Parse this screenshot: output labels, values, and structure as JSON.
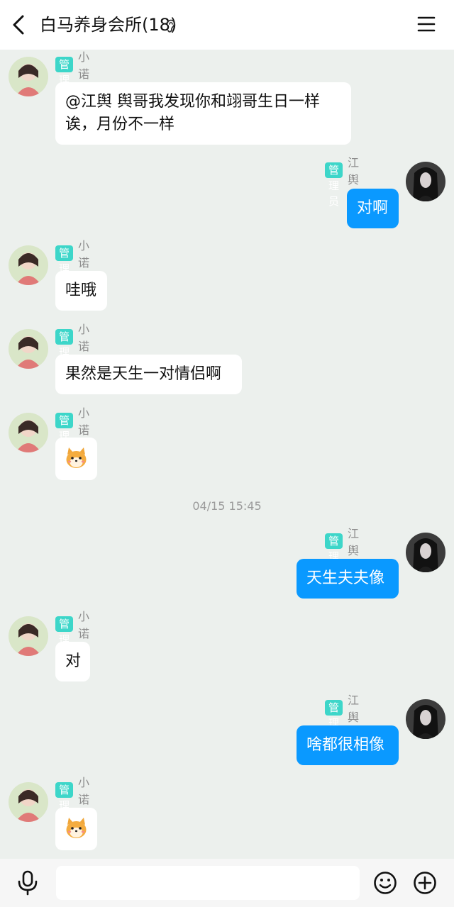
{
  "header": {
    "title": "白马养身会所(18)",
    "back_icon": "back-arrow-icon",
    "ear_icon": "ear-icon",
    "menu_icon": "hamburger-menu-icon"
  },
  "roles": {
    "admin": "管理员"
  },
  "users": {
    "xiaonuo": "小诺",
    "jiangyu": "江舆"
  },
  "messages": [
    {
      "text": "@江舆 舆哥我发现你和翊哥生日一样\n诶，月份不一样"
    },
    {
      "text": "对啊"
    },
    {
      "text": "哇哦"
    },
    {
      "text": "果然是天生一对情侣啊"
    },
    {
      "sticker": "shiba-dog-sticker"
    },
    {
      "text": "天生夫夫像"
    },
    {
      "text": "对"
    },
    {
      "text": "啥都很相像"
    },
    {
      "sticker": "shiba-dog-sticker"
    }
  ],
  "timestamp": "04/15 15:45",
  "footer": {
    "input_placeholder": "",
    "mic_icon": "microphone-icon",
    "emoji_icon": "smiley-icon",
    "plus_icon": "plus-circle-icon"
  },
  "colors": {
    "badge": "#3dd6c9",
    "outgoing_bubble": "#0a99ff",
    "background": "#ecf0ed"
  }
}
